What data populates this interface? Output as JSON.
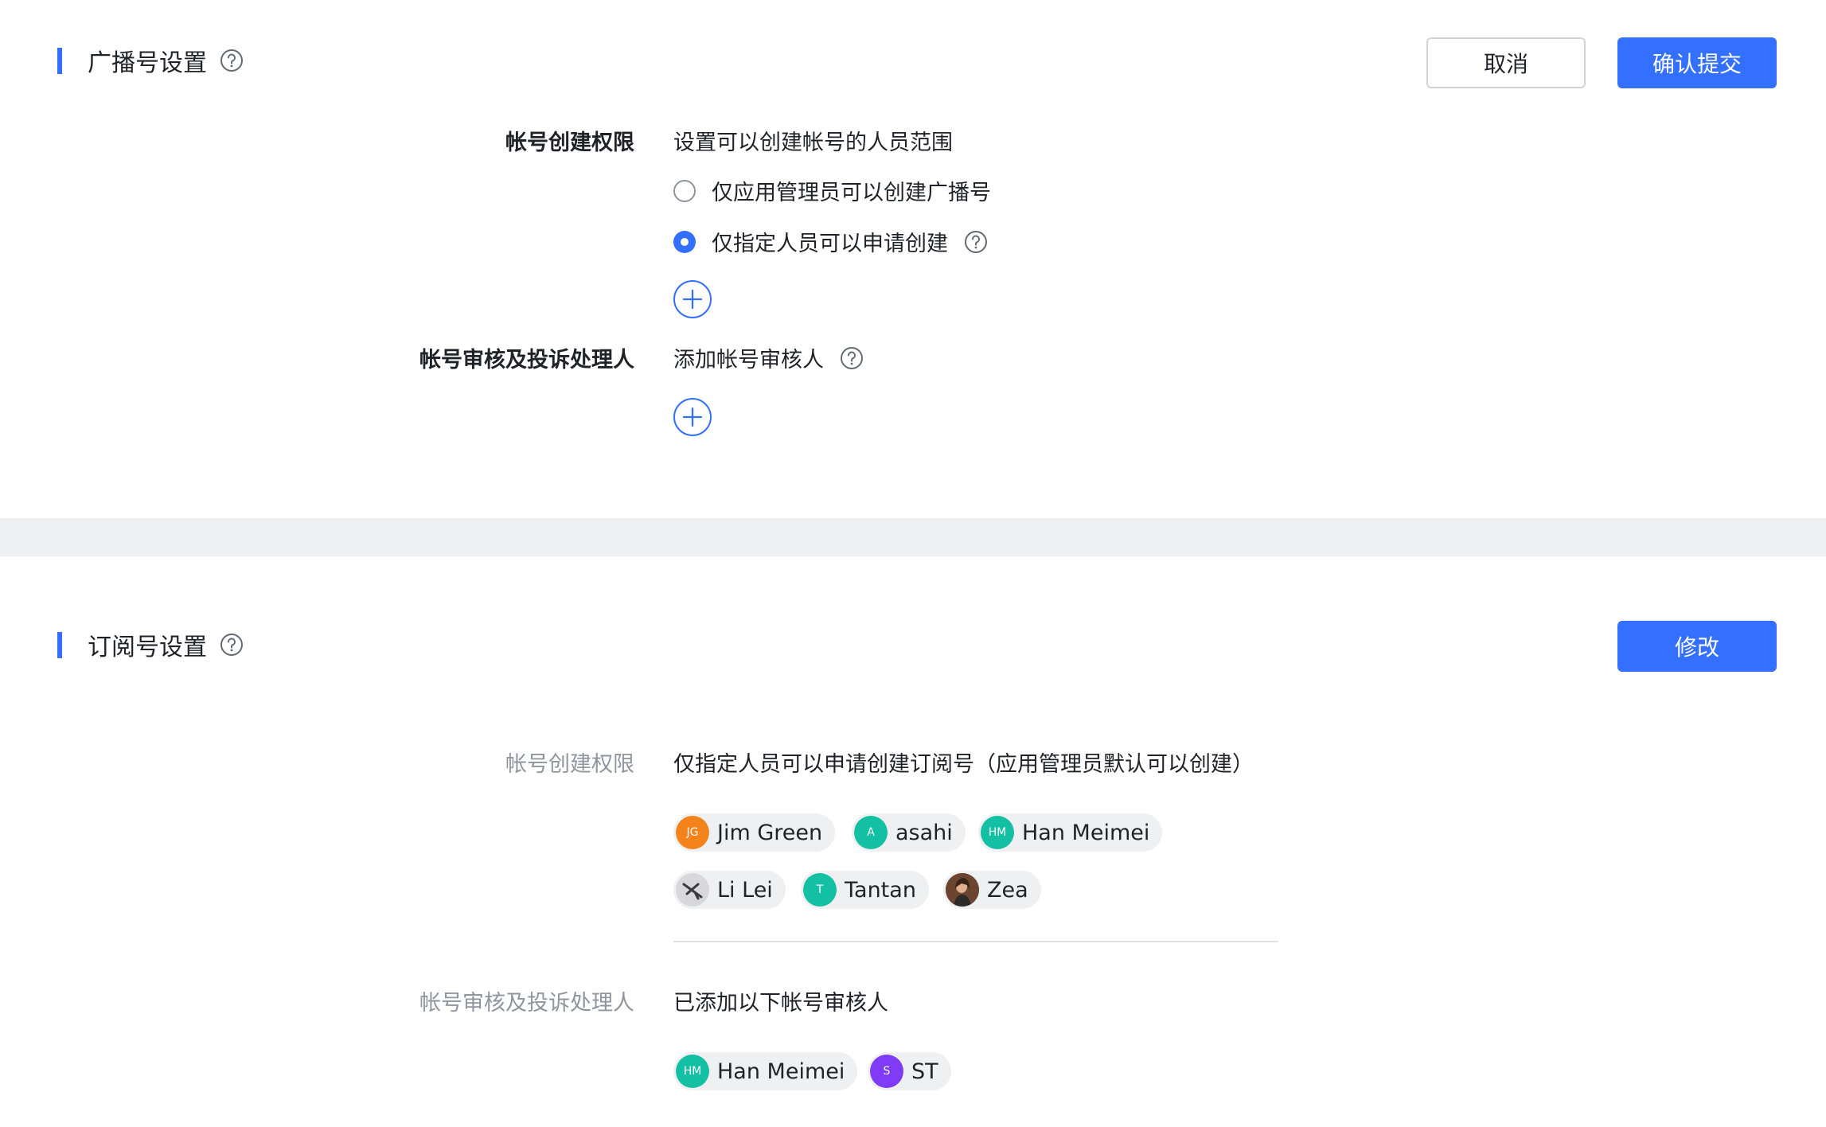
{
  "broadcast": {
    "title": "广播号设置",
    "cancel_label": "取消",
    "submit_label": "确认提交",
    "create_perm_label": "帐号创建权限",
    "create_perm_desc": "设置可以创建帐号的人员范围",
    "options": [
      {
        "label": "仅应用管理员可以创建广播号",
        "selected": false
      },
      {
        "label": "仅指定人员可以申请创建",
        "selected": true
      }
    ],
    "reviewer_label": "帐号审核及投诉处理人",
    "reviewer_desc": "添加帐号审核人"
  },
  "subscription": {
    "title": "订阅号设置",
    "edit_label": "修改",
    "create_perm_label": "帐号创建权限",
    "create_perm_value": "仅指定人员可以申请创建订阅号（应用管理员默认可以创建）",
    "creators": [
      {
        "name": "Jim Green",
        "initials": "JG",
        "color": "#f5831b"
      },
      {
        "name": "asahi",
        "initials": "A",
        "color": "#14c0a4"
      },
      {
        "name": "Han Meimei",
        "initials": "HM",
        "color": "#14c0a4"
      },
      {
        "name": "Li Lei",
        "initials": "",
        "color": "#d8d8dc"
      },
      {
        "name": "Tantan",
        "initials": "T",
        "color": "#14c0a4"
      },
      {
        "name": "Zea",
        "initials": "",
        "color": "#8a5a3b"
      }
    ],
    "reviewer_label": "帐号审核及投诉处理人",
    "reviewer_value": "已添加以下帐号审核人",
    "reviewers": [
      {
        "name": "Han Meimei",
        "initials": "HM",
        "color": "#14c0a4"
      },
      {
        "name": "ST",
        "initials": "S",
        "color": "#7f3bf5"
      }
    ]
  },
  "colors": {
    "accent": "#3370ff",
    "section_gap": "#eff0f1"
  }
}
